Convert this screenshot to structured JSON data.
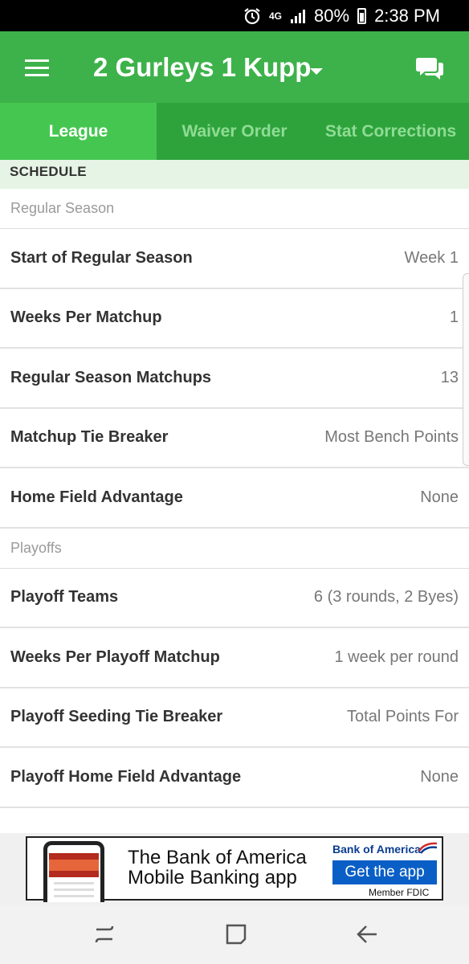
{
  "status_bar": {
    "network": "4G",
    "battery": "80%",
    "time": "2:38 PM",
    "icons": [
      "alarm-icon",
      "signal-icon",
      "battery-icon"
    ]
  },
  "header": {
    "title": "2 Gurleys 1 Kupp",
    "menu_icon": "hamburger-menu-icon",
    "dropdown_icon": "caret-down-icon",
    "chat_icon": "chat-bubbles-icon"
  },
  "tabs": [
    {
      "label": "League",
      "active": true
    },
    {
      "label": "Waiver Order",
      "active": false
    },
    {
      "label": "Stat Corrections",
      "active": false
    }
  ],
  "section": {
    "title": "SCHEDULE"
  },
  "regular_season": {
    "label": "Regular Season",
    "rows": [
      {
        "label": "Start of Regular Season",
        "value": "Week 1"
      },
      {
        "label": "Weeks Per Matchup",
        "value": "1"
      },
      {
        "label": "Regular Season Matchups",
        "value": "13"
      },
      {
        "label": "Matchup Tie Breaker",
        "value": "Most Bench Points"
      },
      {
        "label": "Home Field Advantage",
        "value": "None"
      }
    ]
  },
  "playoffs": {
    "label": "Playoffs",
    "rows": [
      {
        "label": "Playoff Teams",
        "value": "6 (3 rounds, 2 Byes)"
      },
      {
        "label": "Weeks Per Playoff Matchup",
        "value": "1 week per round"
      },
      {
        "label": "Playoff Seeding Tie Breaker",
        "value": "Total Points For"
      },
      {
        "label": "Playoff Home Field Advantage",
        "value": "None"
      }
    ]
  },
  "ad": {
    "line1": "The Bank of America",
    "line2": "Mobile Banking app",
    "brand": "Bank of America",
    "cta": "Get the app",
    "fdic": "Member FDIC",
    "colors": {
      "brand_blue": "#0a5fc6",
      "brand_red": "#d12b2b"
    }
  },
  "nav_bar": {
    "icons": [
      "recent-apps-icon",
      "home-icon",
      "back-icon"
    ]
  },
  "colors": {
    "header_green": "#3db24a",
    "tab_bar_green": "#2ea33c",
    "active_tab_green": "#45c650",
    "section_bg": "#e6f4e6"
  }
}
